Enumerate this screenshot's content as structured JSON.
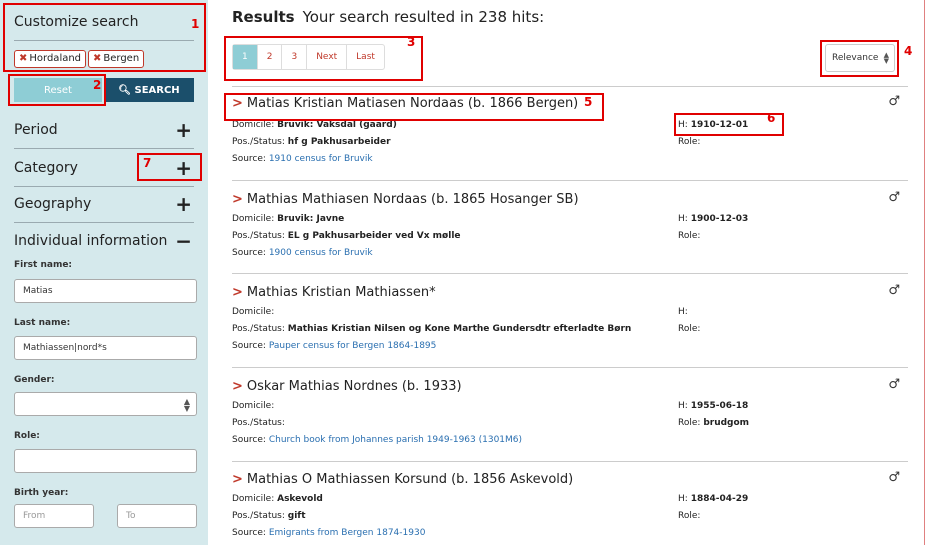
{
  "sidebar": {
    "title": "Customize search",
    "tags": [
      "Hordaland",
      "Bergen"
    ],
    "tag_remove_icon": "x-icon",
    "reset_label": "Reset",
    "search_label": "SEARCH",
    "sections": [
      {
        "label": "Period",
        "symbol": "+"
      },
      {
        "label": "Category",
        "symbol": "+"
      },
      {
        "label": "Geography",
        "symbol": "+"
      },
      {
        "label": "Individual information",
        "symbol": "−"
      }
    ],
    "first_name_label": "First name:",
    "first_name_value": "Matias",
    "last_name_label": "Last name:",
    "last_name_value": "Mathiassen|nord*s",
    "gender_label": "Gender:",
    "gender_value": "",
    "role_label": "Role:",
    "role_value": "",
    "birth_year_label": "Birth year:",
    "from_placeholder": "From",
    "to_placeholder": "To"
  },
  "results": {
    "heading": "Results",
    "summary": "Your search resulted in 238 hits:",
    "pages": [
      "1",
      "2",
      "3",
      "Next",
      "Last"
    ],
    "active_page": "1",
    "sort_value": "Relevance"
  },
  "labels": {
    "domicile": "Domicile:",
    "pos": "Pos./Status:",
    "source": "Source:",
    "h": "H:",
    "role": "Role:"
  },
  "entries": [
    {
      "name": "Matias Kristian Matiasen Nordaas (b. 1866 Bergen)",
      "domicile": "Bruvik: Vaksdal (gaard)",
      "pos": "hf g Pakhusarbeider",
      "source": "1910 census for Bruvik",
      "h": "1910-12-01",
      "role": "",
      "gender": "♂"
    },
    {
      "name": "Mathias Mathiasen Nordaas (b. 1865 Hosanger SB)",
      "domicile": "Bruvik: Javne",
      "pos": "EL g Pakhusarbeider ved Vx mølle",
      "source": "1900 census for Bruvik",
      "h": "1900-12-03",
      "role": "",
      "gender": "♂"
    },
    {
      "name": "Mathias Kristian Mathiassen*",
      "domicile": "",
      "pos": "Mathias Kristian Nilsen og Kone Marthe Gundersdtr efterladte Børn",
      "source": "Pauper census for Bergen 1864-1895",
      "h": "",
      "role": "",
      "gender": "♂"
    },
    {
      "name": "Oskar Mathias Nordnes (b. 1933)",
      "domicile": "",
      "pos": "",
      "source": "Church book from Johannes parish 1949-1963 (1301M6)",
      "h": "1955-06-18",
      "role": "brudgom",
      "gender": "♂"
    },
    {
      "name": "Mathias O Mathiassen Korsund (b. 1856 Askevold)",
      "domicile": "Askevold",
      "pos": "gift",
      "source": "Emigrants from Bergen 1874-1930",
      "h": "1884-04-29",
      "role": "",
      "gender": "♂"
    }
  ],
  "annotations": [
    "1",
    "2",
    "3",
    "4",
    "5",
    "6",
    "7"
  ],
  "colors": {
    "accent": "#c0392b",
    "sidebar_bg": "#d5e9ec",
    "search_btn": "#1b4f6b",
    "reset_btn": "#8ecdd5",
    "annotation": "#e00000",
    "link": "#2a6fb0"
  }
}
